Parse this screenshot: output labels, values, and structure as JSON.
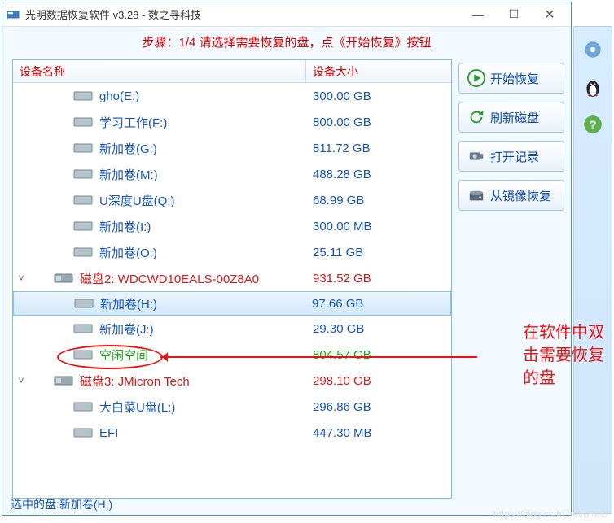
{
  "title": "光明数据恢复软件 v3.28 - 数之寻科技",
  "step_instruction": "步骤：1/4 请选择需要恢复的盘，点《开始恢复》按钮",
  "columns": {
    "name": "设备名称",
    "size": "设备大小"
  },
  "rows": [
    {
      "level": 2,
      "name": "gho(E:)",
      "size": "300.00 GB",
      "color": "blue"
    },
    {
      "level": 2,
      "name": "学习工作(F:)",
      "size": "800.00 GB",
      "color": "blue"
    },
    {
      "level": 2,
      "name": "新加卷(G:)",
      "size": "811.72 GB",
      "color": "blue"
    },
    {
      "level": 2,
      "name": "新加卷(M:)",
      "size": "488.28 GB",
      "color": "blue"
    },
    {
      "level": 2,
      "name": "U深度U盘(Q:)",
      "size": "68.99 GB",
      "color": "blue"
    },
    {
      "level": 2,
      "name": "新加卷(I:)",
      "size": "300.00 MB",
      "color": "blue"
    },
    {
      "level": 2,
      "name": "新加卷(O:)",
      "size": "25.11 GB",
      "color": "blue"
    },
    {
      "level": 1,
      "name": "磁盘2: WDCWD10EALS-00Z8A0",
      "size": "931.52 GB",
      "color": "red",
      "expander": "˅"
    },
    {
      "level": 2,
      "name": "新加卷(H:)",
      "size": "97.66 GB",
      "color": "blue",
      "selected": true
    },
    {
      "level": 2,
      "name": "新加卷(J:)",
      "size": "29.30 GB",
      "color": "blue"
    },
    {
      "level": 2,
      "name": "空闲空间",
      "size": "804.57 GB",
      "color": "green"
    },
    {
      "level": 1,
      "name": "磁盘3: JMicron  Tech",
      "size": "298.10 GB",
      "color": "red",
      "expander": "˅"
    },
    {
      "level": 2,
      "name": "大白菜U盘(L:)",
      "size": "296.86 GB",
      "color": "blue"
    },
    {
      "level": 2,
      "name": "EFI",
      "size": "447.30 MB",
      "color": "blue"
    }
  ],
  "buttons": {
    "start": "开始恢复",
    "refresh": "刷新磁盘",
    "log": "打开记录",
    "image": "从镜像恢复"
  },
  "statusbar": "选中的盘:新加卷(H:)",
  "annotation": "在软件中双击需要恢复的盘",
  "watermark": "https://blog.csdn.net/ajhnb"
}
